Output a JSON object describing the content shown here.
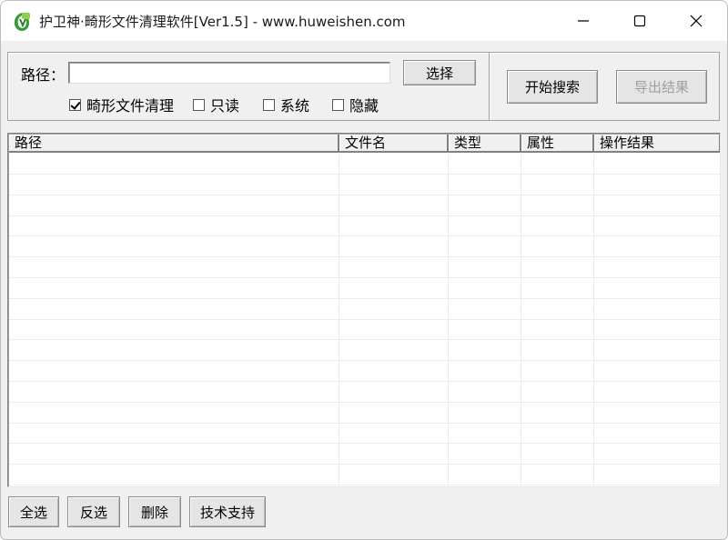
{
  "window": {
    "title": "护卫神·畸形文件清理软件[Ver1.5] - www.huweishen.com",
    "icon": "leaf-shield-icon",
    "controls": {
      "minimize": "minimize-icon",
      "maximize": "maximize-icon",
      "close": "close-icon"
    }
  },
  "search": {
    "path_label": "路径：",
    "path_value": "",
    "select_label": "选择",
    "start_label": "开始搜索",
    "export_label": "导出结果"
  },
  "options": [
    {
      "label": "畸形文件清理",
      "checked": true
    },
    {
      "label": "只读",
      "checked": false
    },
    {
      "label": "系统",
      "checked": false
    },
    {
      "label": "隐藏",
      "checked": false
    }
  ],
  "table": {
    "columns": [
      "路径",
      "文件名",
      "类型",
      "属性",
      "操作结果"
    ],
    "rows": []
  },
  "footer": {
    "select_all": "全选",
    "invert": "反选",
    "delete": "删除",
    "support": "技术支持"
  },
  "colors": {
    "window_bg": "#f0f0f0",
    "titlebar_bg": "#ffffff",
    "disabled_text": "#a0a0a0"
  }
}
